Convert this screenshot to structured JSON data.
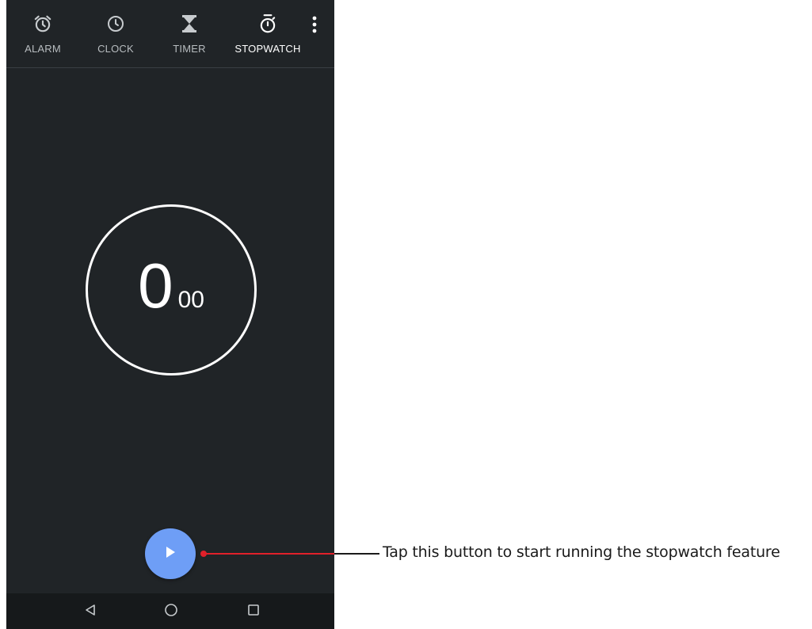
{
  "tabs": [
    {
      "label": "ALARM",
      "icon": "alarm-clock-icon"
    },
    {
      "label": "CLOCK",
      "icon": "clock-icon"
    },
    {
      "label": "TIMER",
      "icon": "hourglass-icon"
    },
    {
      "label": "STOPWATCH",
      "icon": "stopwatch-icon",
      "active": true
    }
  ],
  "overflow_icon": "more-vert-icon",
  "stopwatch": {
    "seconds": "0",
    "hundredths": "00"
  },
  "fab_icon": "play-icon",
  "navbar": {
    "icons": [
      "back-icon",
      "home-icon",
      "recents-icon"
    ]
  },
  "annotation": {
    "text": "Tap this button to start running the stopwatch feature",
    "color": "#e0202a"
  },
  "colors": {
    "background": "#202427",
    "accent": "#6e9ef6"
  }
}
